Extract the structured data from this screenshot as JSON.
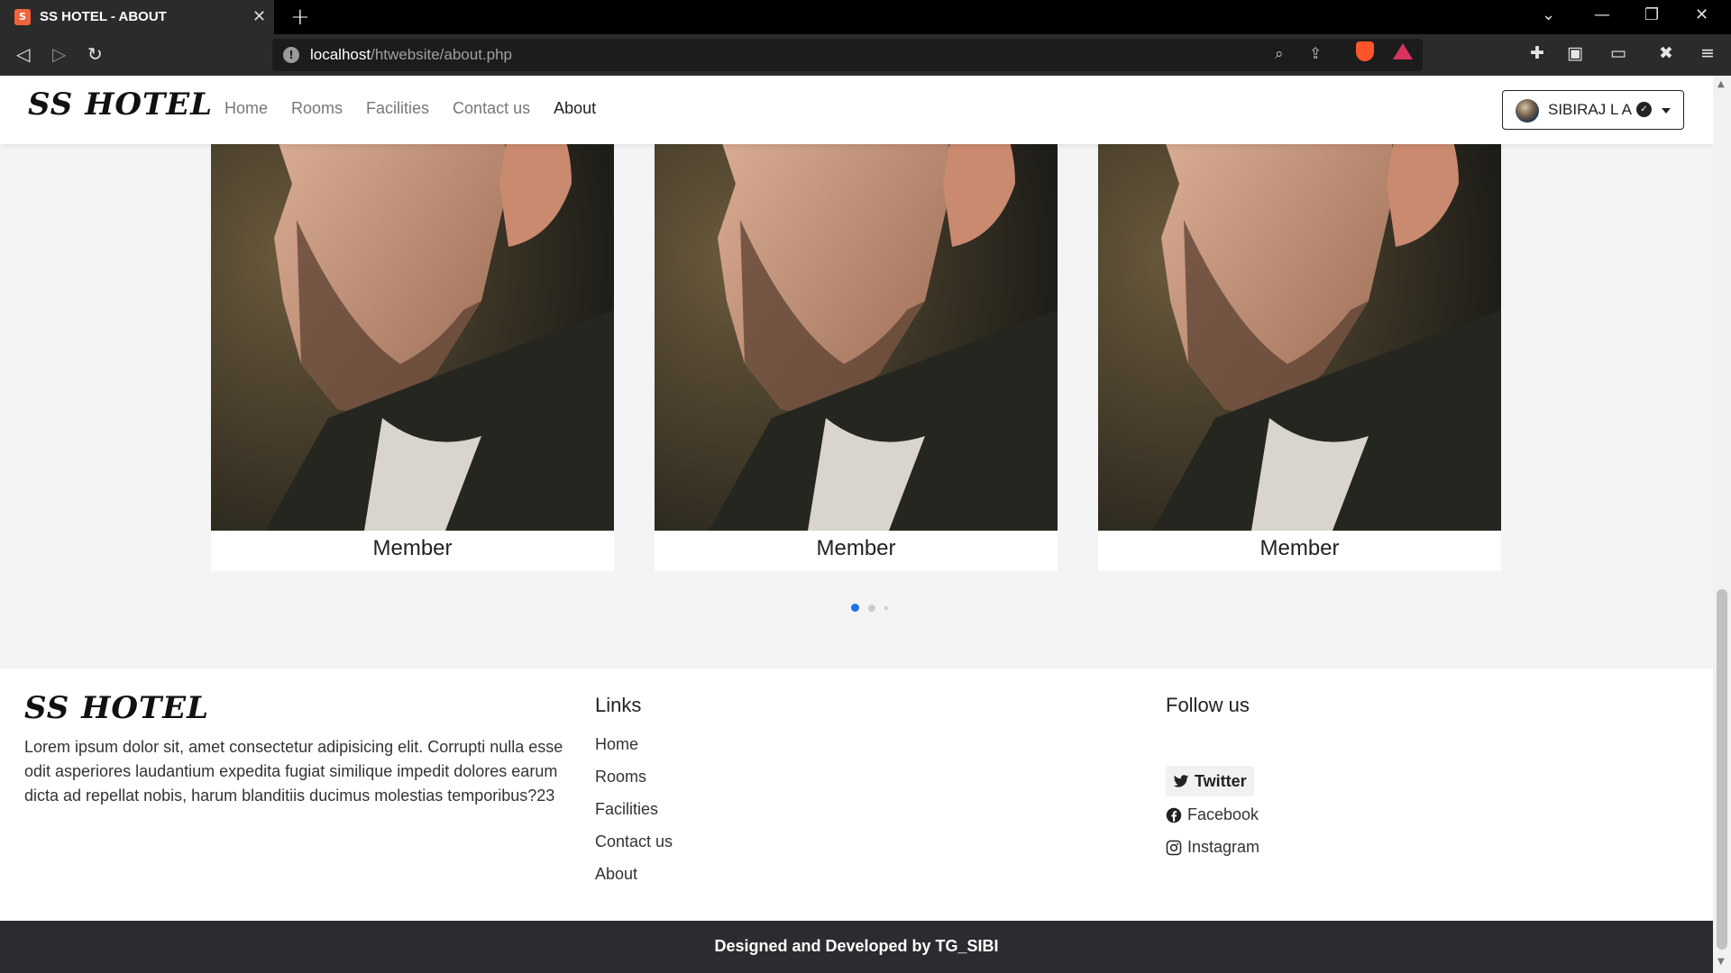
{
  "browser": {
    "tab_title": "SS HOTEL - ABOUT",
    "url_host": "localhost",
    "url_path": "/htwebsite/about.php",
    "favicon_letter": "S"
  },
  "site": {
    "brand": "SS HOTEL",
    "nav": [
      {
        "label": "Home",
        "active": false
      },
      {
        "label": "Rooms",
        "active": false
      },
      {
        "label": "Facilities",
        "active": false
      },
      {
        "label": "Contact us",
        "active": false
      },
      {
        "label": "About",
        "active": true
      }
    ],
    "user_name": "SIBIRAJ L A"
  },
  "team": {
    "members": [
      {
        "name": "Member"
      },
      {
        "name": "Member"
      },
      {
        "name": "Member"
      }
    ],
    "carousel_active_index": 0,
    "carousel_dots": 3
  },
  "footer": {
    "brand": "SS HOTEL",
    "description": "Lorem ipsum dolor sit, amet consectetur adipisicing elit. Corrupti nulla esse odit asperiores laudantium expedita fugiat similique impedit dolores earum dicta ad repellat nobis, harum blanditiis ducimus molestias temporibus?23",
    "links_heading": "Links",
    "links": [
      "Home",
      "Rooms",
      "Facilities",
      "Contact us",
      "About"
    ],
    "follow_heading": "Follow us",
    "twitter": "Twitter",
    "facebook": "Facebook",
    "instagram": "Instagram",
    "credit": "Designed and Developed by TG_SIBI"
  },
  "colors": {
    "accent_blue": "#1a73e8",
    "footer_bar": "#2a2c30",
    "page_bg": "#f4f4f4"
  }
}
